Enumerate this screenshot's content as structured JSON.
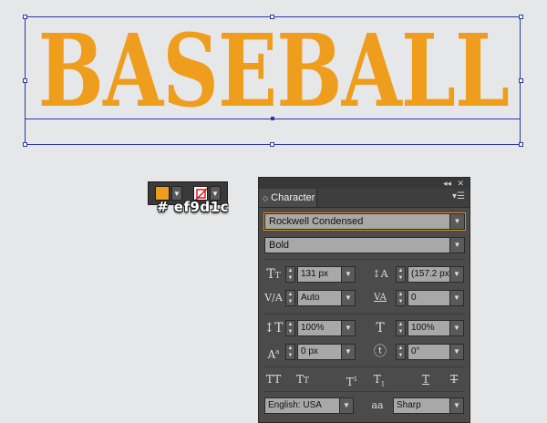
{
  "canvas": {
    "text": "BASEBALL",
    "text_color": "#ef9d1c",
    "selection_color": "#2b3aa8"
  },
  "swatch": {
    "fill_color": "#ef9d1c",
    "hex_label": "# ef9d1c",
    "stroke": "none"
  },
  "panel": {
    "title": "Character",
    "font_family": "Rockwell Condensed",
    "font_style": "Bold",
    "font_size": "131 px",
    "leading": "(157.2 px)",
    "kerning": "Auto",
    "tracking": "0",
    "vertical_scale": "100%",
    "horizontal_scale": "100%",
    "baseline_shift": "0 px",
    "rotation": "0°",
    "language": "English: USA",
    "antialiasing_icon_text": "aa",
    "antialiasing": "Sharp",
    "highlight_color": "#e08a1a"
  },
  "icons": {
    "font_size": "font-size-icon",
    "leading": "leading-icon",
    "kerning": "kerning-icon",
    "tracking": "tracking-icon",
    "vertical_scale": "vertical-scale-icon",
    "horizontal_scale": "horizontal-scale-icon",
    "baseline_shift": "baseline-shift-icon",
    "rotation": "character-rotation-icon"
  }
}
